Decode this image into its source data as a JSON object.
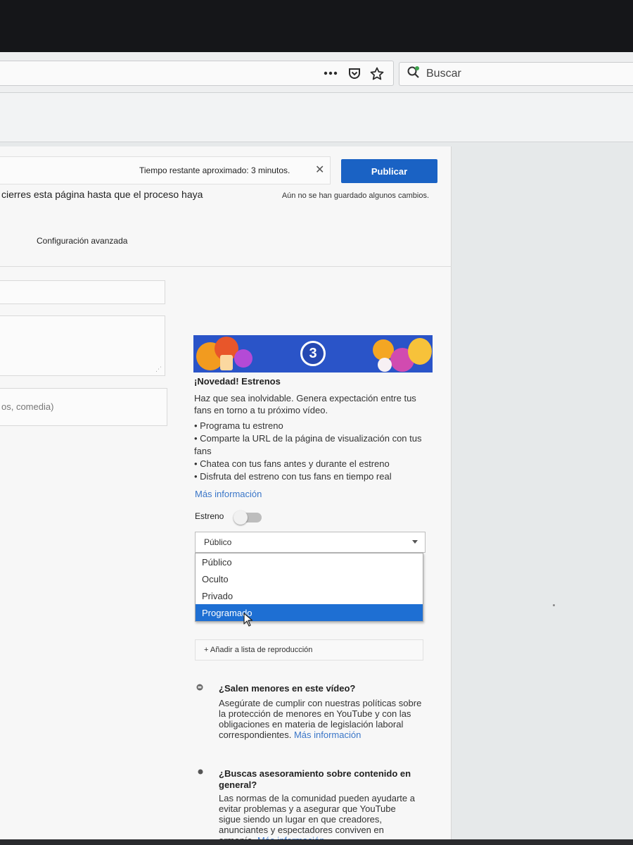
{
  "browser": {
    "menu_icon": "more-dots-icon",
    "search_placeholder": "Buscar"
  },
  "upload": {
    "time_remaining": "Tiempo restante aproximado: 3 minutos.",
    "publish_label": "Publicar",
    "warning_text": "cierres esta página hasta que el proceso haya",
    "unsaved_text": "Aún no se han guardado algunos cambios.",
    "advanced_tab": "Configuración avanzada",
    "tags_placeholder": "os, comedia)"
  },
  "premiere": {
    "banner_number": "3",
    "title": "¡Novedad! Estrenos",
    "description": "Haz que sea inolvidable. Genera expectación entre tus fans en torno a tu próximo vídeo.",
    "bullets": [
      "Programa tu estreno",
      "Comparte la URL de la página de visualización con tus fans",
      "Chatea con tus fans antes y durante el estreno",
      "Disfruta del estreno con tus fans en tiempo real"
    ],
    "more_info": "Más información",
    "toggle_label": "Estreno"
  },
  "privacy": {
    "selected": "Público",
    "options": [
      "Público",
      "Oculto",
      "Privado",
      "Programado"
    ],
    "highlighted_index": 3
  },
  "playlist_label": "+ Añadir a lista de reproducción",
  "info": {
    "minors_title": "¿Salen menores en este vídeo?",
    "minors_body": "Asegúrate de cumplir con nuestras políticas sobre la protección de menores en YouTube y con las obligaciones en materia de legislación laboral correspondientes.",
    "minors_link": "Más información",
    "guidance_title": "¿Buscas asesoramiento sobre contenido en general?",
    "guidance_body": "Las normas de la comunidad pueden ayudarte a evitar problemas y a asegurar que YouTube sigue siendo un lugar en que creadores, anunciantes y espectadores conviven en armonía.",
    "guidance_link": "Más información"
  },
  "colors": {
    "publish": "#1a62c4",
    "link": "#3a76c8",
    "option_highlight": "#1e6fd3"
  }
}
